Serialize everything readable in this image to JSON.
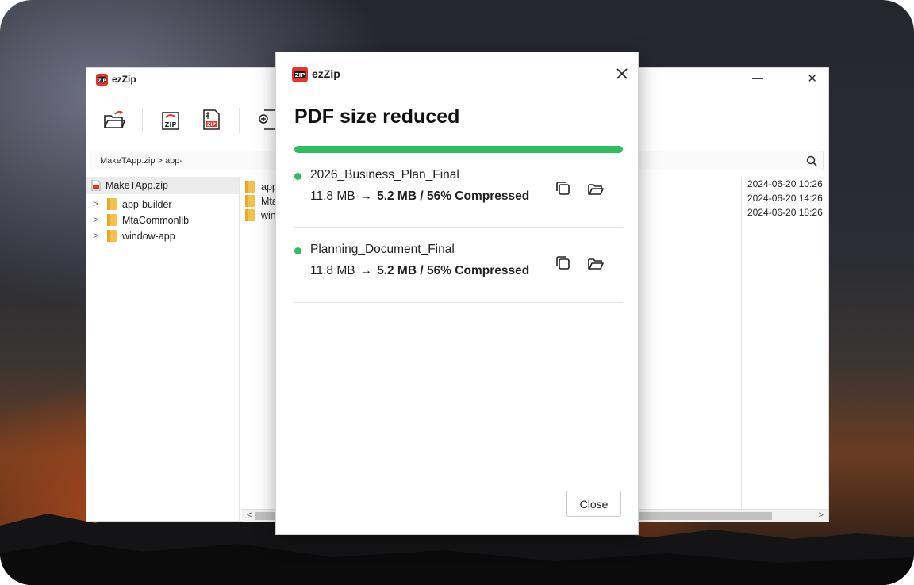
{
  "background_window": {
    "title": "ezZip",
    "minimize_label": "—",
    "close_label": "✕",
    "address_path": "MakeTApp.zip > app-",
    "tree": {
      "root": "MakeTApp.zip",
      "items": [
        "app-builder",
        "MtaCommonlib",
        "window-app"
      ]
    },
    "list_items": [
      "app",
      "Mta",
      "win"
    ],
    "dates": [
      "2024-06-20  10:26",
      "2024-06-20  14:26",
      "2024-06-20  18:26"
    ]
  },
  "dialog": {
    "app_name": "ezZip",
    "heading": "PDF size reduced",
    "progress_percent": 100,
    "files": [
      {
        "name": "2026_Business_Plan_Final",
        "original_size": "11.8 MB",
        "arrow": "→",
        "result": "5.2 MB / 56% Compressed"
      },
      {
        "name": "Planning_Document_Final",
        "original_size": "11.8 MB",
        "arrow": "→",
        "result": "5.2 MB / 56% Compressed"
      }
    ],
    "close_button_label": "Close"
  },
  "colors": {
    "accent_green": "#2fbe5f",
    "logo_red": "#e8352b"
  },
  "icons": {
    "app_logo": "zip-logo-icon",
    "dialog_close": "close-icon",
    "copy": "copy-icon",
    "open_folder": "folder-open-icon"
  }
}
